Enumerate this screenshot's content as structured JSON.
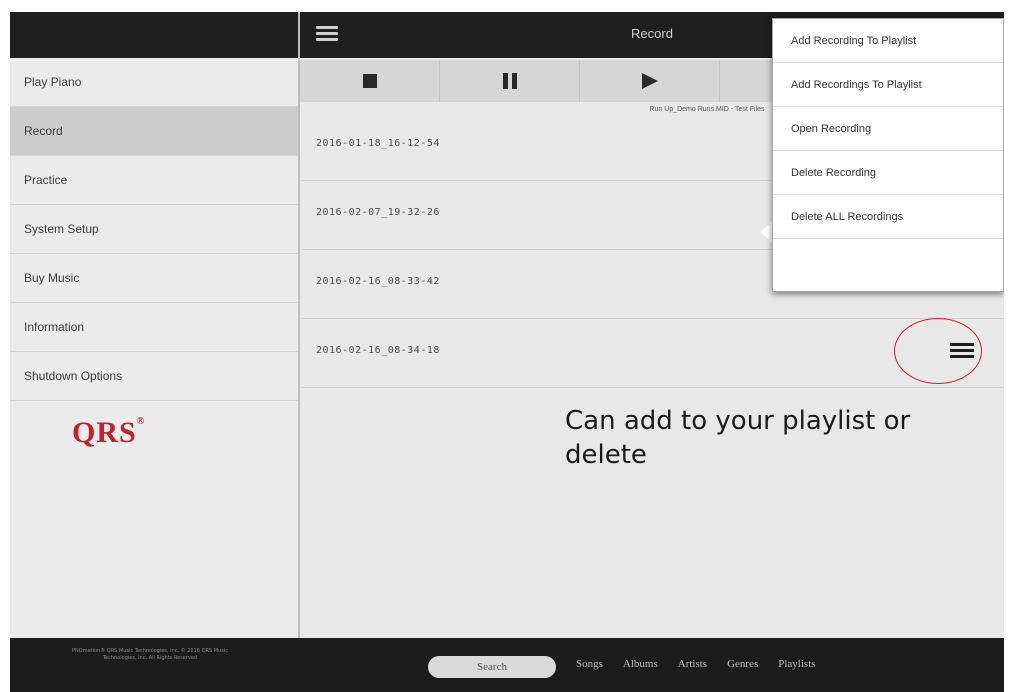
{
  "header": {
    "title": "Record"
  },
  "sidebar": {
    "items": [
      {
        "label": "Play Piano",
        "active": false
      },
      {
        "label": "Record",
        "active": true
      },
      {
        "label": "Practice",
        "active": false
      },
      {
        "label": "System Setup",
        "active": false
      },
      {
        "label": "Buy Music",
        "active": false
      },
      {
        "label": "Information",
        "active": false
      },
      {
        "label": "Shutdown Options",
        "active": false
      }
    ],
    "logo": "QRS",
    "logo_mark": "®"
  },
  "transport": {
    "stop_icon": "stop-icon",
    "pause_icon": "pause-icon",
    "play_icon": "play-icon",
    "subline": "Run Up_Demo Runs.MID - Test Files"
  },
  "recordings": [
    {
      "name": "2016-01-18_16-12-54"
    },
    {
      "name": "2016-02-07_19-32-26"
    },
    {
      "name": "2016-02-16_08-33-42"
    },
    {
      "name": "2016-02-16_08-34-18"
    }
  ],
  "popover": {
    "items": [
      {
        "label": "Add Recording To Playlist"
      },
      {
        "label": "Add Recordings To Playlist"
      },
      {
        "label": "Open Recording"
      },
      {
        "label": "Delete Recording"
      },
      {
        "label": "Delete ALL Recordings"
      }
    ]
  },
  "annotation": {
    "text": "Can add to your playlist or delete"
  },
  "footer": {
    "copyright": "PNOmation® QRS Music Technologies, Inc. © 2016 QRS Music Technologies, Inc. All Rights Reserved",
    "search_label": "Search",
    "nav": [
      "Songs",
      "Albums",
      "Artists",
      "Genres",
      "Playlists"
    ]
  },
  "colors": {
    "highlight_circle": "#d11f2a",
    "logo": "#c0222c",
    "header_bg": "#1f1f1f"
  }
}
